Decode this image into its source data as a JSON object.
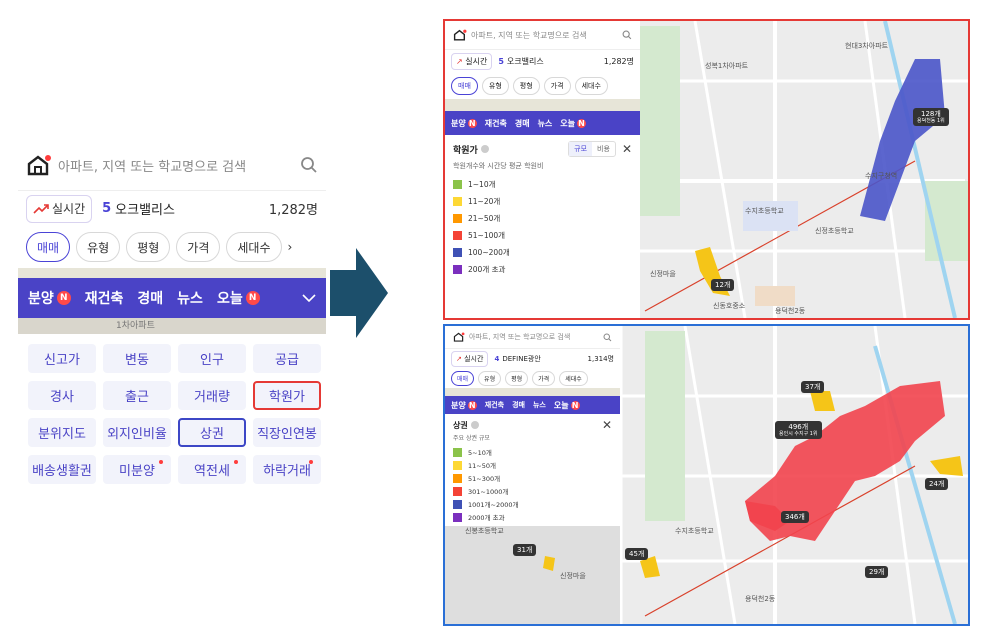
{
  "app": {
    "search_placeholder": "아파트, 지역 또는 학교명으로 검색",
    "realtime_label": "실시간",
    "rank_number": "5",
    "rank_name": "오크밸리스",
    "count": "1,282명",
    "filter_chips": [
      "매매",
      "유형",
      "평형",
      "가격",
      "세대수"
    ],
    "nav_items": [
      {
        "label": "분양",
        "badge": "N"
      },
      {
        "label": "재건축",
        "badge": ""
      },
      {
        "label": "경매",
        "badge": ""
      },
      {
        "label": "뉴스",
        "badge": ""
      },
      {
        "label": "오늘",
        "badge": "N"
      }
    ],
    "map_peek_text": "1차아파트",
    "grid": [
      {
        "label": "신고가"
      },
      {
        "label": "변동"
      },
      {
        "label": "인구"
      },
      {
        "label": "공급"
      },
      {
        "label": "경사"
      },
      {
        "label": "출근"
      },
      {
        "label": "거래량"
      },
      {
        "label": "학원가",
        "highlight": "red"
      },
      {
        "label": "분위지도"
      },
      {
        "label": "외지인비율"
      },
      {
        "label": "상권",
        "highlight": "blue"
      },
      {
        "label": "직장인연봉"
      },
      {
        "label": "배송생활권"
      },
      {
        "label": "미분양",
        "dot": true
      },
      {
        "label": "역전세",
        "dot": true
      },
      {
        "label": "하락거래",
        "dot": true
      }
    ]
  },
  "top_panel": {
    "search_placeholder": "아파트, 지역 또는 학교명으로 검색",
    "realtime_label": "실시간",
    "rank_number": "5",
    "rank_name": "오크밸리스",
    "count": "1,282명",
    "chips": [
      "매매",
      "유형",
      "평형",
      "가격",
      "세대수"
    ],
    "nav": [
      "분양",
      "재건축",
      "경매",
      "뉴스",
      "오늘"
    ],
    "legend": {
      "title": "학원가",
      "tab_a": "규모",
      "tab_b": "비용",
      "subtitle": "학원개수와 시간당 평균 학원비",
      "items": [
        {
          "label": "1~10개",
          "color": "#8bc34a"
        },
        {
          "label": "11~20개",
          "color": "#fdd835"
        },
        {
          "label": "21~50개",
          "color": "#ff9800"
        },
        {
          "label": "51~100개",
          "color": "#f44336"
        },
        {
          "label": "100~200개",
          "color": "#3f51b5"
        },
        {
          "label": "200개 초과",
          "color": "#7b2fbe"
        }
      ]
    },
    "tags": [
      {
        "main": "128개",
        "sub": "용덕천동 1위"
      },
      {
        "main": "12개",
        "sub": ""
      }
    ],
    "place_labels": [
      "신정마을",
      "수지구청역",
      "용덕천2동",
      "신동호중소",
      "수지초등학교",
      "성복1차아파트",
      "신정초등학교",
      "현대3차아파트"
    ]
  },
  "bottom_panel": {
    "search_placeholder": "아파트, 지역 또는 학교명으로 검색",
    "realtime_label": "실시간",
    "rank_number": "4",
    "rank_name": "DEFINE광안",
    "count": "1,314명",
    "chips": [
      "매매",
      "유형",
      "평형",
      "가격",
      "세대수"
    ],
    "nav": [
      "분양",
      "재건축",
      "경매",
      "뉴스",
      "오늘"
    ],
    "legend": {
      "title": "상권",
      "subtitle": "주요 상권 규모",
      "items": [
        {
          "label": "5~10개",
          "color": "#8bc34a"
        },
        {
          "label": "11~50개",
          "color": "#fdd835"
        },
        {
          "label": "51~300개",
          "color": "#ff9800"
        },
        {
          "label": "301~1000개",
          "color": "#f44336"
        },
        {
          "label": "1001개~2000개",
          "color": "#3f51b5"
        },
        {
          "label": "2000개 초과",
          "color": "#7b2fbe"
        }
      ]
    },
    "tags": [
      {
        "main": "37개",
        "sub": ""
      },
      {
        "main": "496개",
        "sub": "용인시 수지구 1위"
      },
      {
        "main": "24개",
        "sub": ""
      },
      {
        "main": "346개",
        "sub": ""
      },
      {
        "main": "31개",
        "sub": ""
      },
      {
        "main": "45개",
        "sub": ""
      },
      {
        "main": "29개",
        "sub": ""
      }
    ],
    "place_labels": [
      "신정마을",
      "용덕천2동",
      "수지초등학교",
      "신봉초등학교"
    ]
  }
}
